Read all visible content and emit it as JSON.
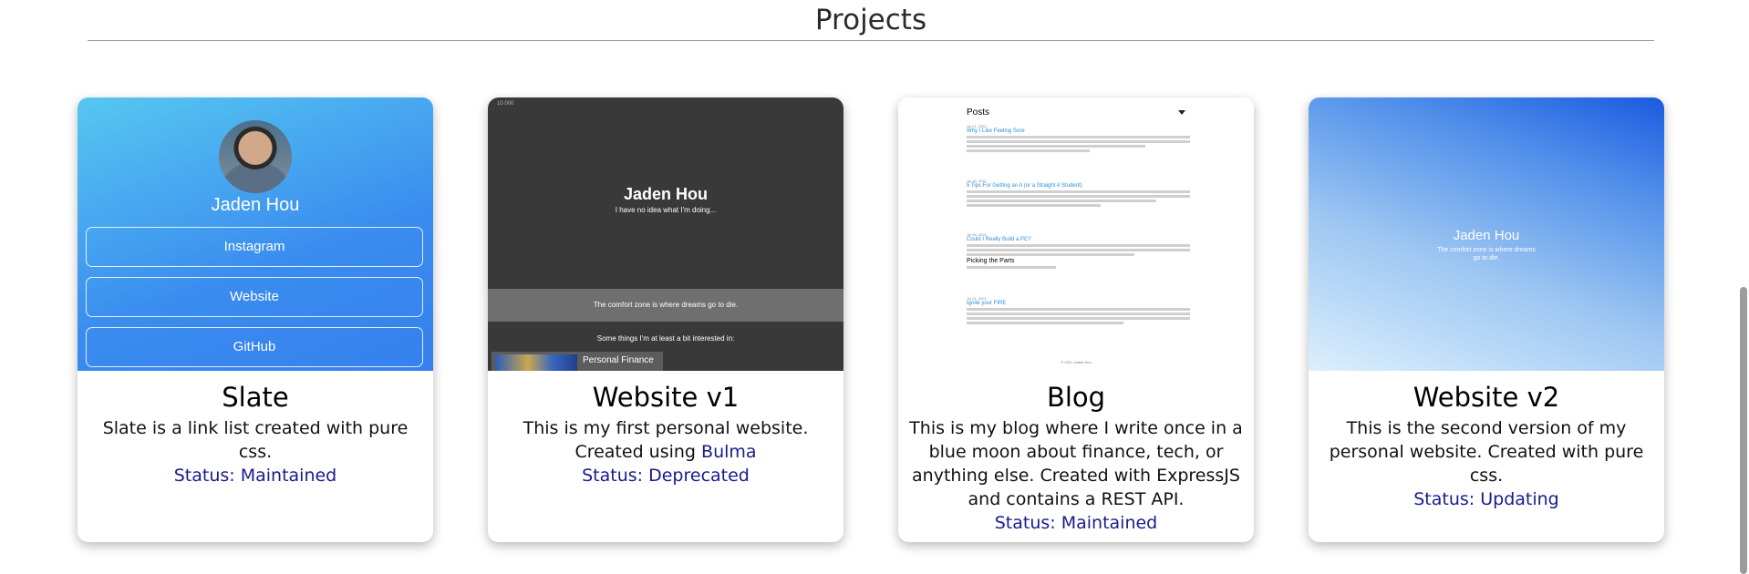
{
  "section": {
    "title": "Projects"
  },
  "projects": [
    {
      "title": "Slate",
      "description": "Slate is a link list created with pure css.",
      "status": "Status: Maintained",
      "preview": {
        "name": "Jaden Hou",
        "links": [
          "Instagram",
          "Website",
          "GitHub"
        ]
      }
    },
    {
      "title": "Website v1",
      "description": "This is my first personal website. Created using",
      "link_text": "Bulma",
      "status": "Status: Deprecated",
      "preview": {
        "top_tag": "10 000",
        "name": "Jaden Hou",
        "tagline": "I have no idea what I'm doing...",
        "band": "The comfort zone is where dreams go to die.",
        "interests": "Some things I'm at least a bit interested in:",
        "tile": "Personal Finance"
      }
    },
    {
      "title": "Blog",
      "description": "This is my blog where I write once in a blue moon about finance, tech, or anything else. Created with ExpressJS and contains a REST API.",
      "status": "Status: Maintained",
      "preview": {
        "heading": "Posts",
        "posts": [
          {
            "date": "Jul 21, 2021",
            "title": "Why I Like Feeling Sore"
          },
          {
            "date": "Jul 18, 2021",
            "title": "5 Tips For Getting an A (or a Straight A Student)"
          },
          {
            "date": "Jul 05, 2021",
            "title": "Could I Really Build a PC?",
            "subheading": "Picking the Parts"
          },
          {
            "date": "Jul 01, 2021",
            "title": "Ignite your FIRE"
          }
        ],
        "footer": "© 2021 Jaden Hou"
      }
    },
    {
      "title": "Website v2",
      "description": "This is the second version of my personal website. Created with pure css.",
      "status": "Status: Updating",
      "preview": {
        "name": "Jaden Hou",
        "tagline": "The comfort zone is where dreams go to die."
      }
    }
  ]
}
